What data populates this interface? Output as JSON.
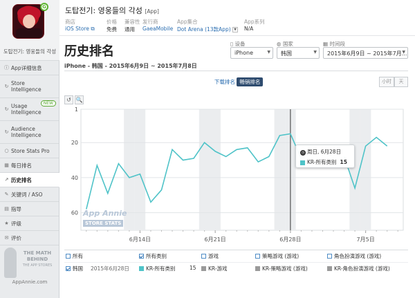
{
  "app": {
    "title": "도탑전기: 영웅들의 각성",
    "title_tag": "[App]",
    "sidebar_name": "도탑전기: 영웅들의 각성",
    "meta": [
      {
        "label": "商店",
        "value": "iOS Store"
      },
      {
        "label": "价格",
        "value": "免费"
      },
      {
        "label": "兼容性",
        "value": "通用"
      },
      {
        "label": "发行商",
        "value": "GaeaMobile"
      },
      {
        "label": "App集合",
        "value": "Dot Arena (13款App)"
      },
      {
        "label": "App系列",
        "value": "N/A"
      }
    ]
  },
  "sidebar": {
    "items": [
      {
        "label": "App详细信息",
        "icon": "ⓘ"
      },
      {
        "label": "Store Intelligence",
        "icon": "↻"
      },
      {
        "label": "Usage Intelligence",
        "icon": "↻",
        "badge": "NEW"
      },
      {
        "label": "Audience Intelligence",
        "icon": "↻"
      },
      {
        "label": "Store Stats Pro",
        "icon": "○"
      },
      {
        "label": "每日排名",
        "icon": "▦"
      },
      {
        "label": "历史排名",
        "icon": "↗"
      },
      {
        "label": "关键词 / ASO",
        "icon": "✎"
      },
      {
        "label": "指导",
        "icon": "▤"
      },
      {
        "label": "评级",
        "icon": "★"
      },
      {
        "label": "评价",
        "icon": "✉"
      }
    ],
    "footer": {
      "line1": "THE MATH",
      "line2": "BEHIND",
      "line3": "THE APP STORES",
      "url": "AppAnnie.com"
    }
  },
  "page": {
    "title": "历史排名",
    "subheading": "iPhone - 韩国 - 2015年6月9日 ~ 2015年7月8日"
  },
  "filters": {
    "device": {
      "label": "设备",
      "value": "iPhone"
    },
    "country": {
      "label": "国家",
      "value": "韩国"
    },
    "date": {
      "label": "时间段",
      "value": "2015年6月9日 ~ 2015年7月..."
    }
  },
  "toolbar": {
    "downloads_label": "下载排名",
    "grossing_label": "畅销排名",
    "hour_label": "小时",
    "day_label": "天",
    "reset_icon": "↺",
    "zoom_icon": "🔍"
  },
  "tooltip": {
    "date": "周日, 6月28日",
    "series": "KR-所有类别",
    "value": "15"
  },
  "watermark": {
    "line1": "App Annie",
    "line2": "STORE STATS"
  },
  "legend": {
    "categories": [
      {
        "label": "所有",
        "checked": false
      },
      {
        "label": "所有类别",
        "checked": true
      },
      {
        "label": "游戏",
        "checked": false
      },
      {
        "label": "策略游戏 (游戏)",
        "checked": false
      },
      {
        "label": "角色扮演游戏 (游戏)",
        "checked": false
      }
    ],
    "row": {
      "country": "韩国",
      "date": "2015年6月28日",
      "items": [
        {
          "name": "KR-所有类别",
          "value": "15",
          "color": "#4fc3c8"
        },
        {
          "name": "KR-游戏",
          "value": "",
          "color": "#9a9a9a"
        },
        {
          "name": "KR-策略游戏 (游戏)",
          "value": "",
          "color": "#9a9a9a"
        },
        {
          "name": "KR-角色扮演游戏 (游戏)",
          "value": "",
          "color": "#9a9a9a"
        }
      ]
    }
  },
  "chart_data": {
    "type": "line",
    "ylim": [
      1,
      70
    ],
    "y_inverted": true,
    "yticks": [
      1,
      20,
      40,
      60
    ],
    "x_start": "2015-06-09",
    "x_end": "2015-07-08",
    "xticks": [
      "6月14日",
      "6月21日",
      "6月28日",
      "7月5日"
    ],
    "grid": true,
    "weekend_bands": true,
    "color": "#4fc3c8",
    "series": [
      {
        "name": "KR-所有类别",
        "x": [
          "2015-06-09",
          "2015-06-10",
          "2015-06-11",
          "2015-06-12",
          "2015-06-13",
          "2015-06-14",
          "2015-06-15",
          "2015-06-16",
          "2015-06-17",
          "2015-06-18",
          "2015-06-19",
          "2015-06-20",
          "2015-06-21",
          "2015-06-22",
          "2015-06-23",
          "2015-06-24",
          "2015-06-25",
          "2015-06-26",
          "2015-06-27",
          "2015-06-28",
          "2015-06-29",
          "2015-06-30",
          "2015-07-01",
          "2015-07-02",
          "2015-07-03",
          "2015-07-04",
          "2015-07-05",
          "2015-07-06",
          "2015-07-07",
          "2015-07-08"
        ],
        "values": [
          58,
          33,
          49,
          32,
          40,
          38,
          54,
          47,
          24,
          30,
          29,
          20,
          25,
          28,
          24,
          23,
          31,
          28,
          16,
          15,
          29,
          null,
          null,
          null,
          28,
          46,
          22,
          17,
          22,
          null
        ]
      }
    ]
  }
}
